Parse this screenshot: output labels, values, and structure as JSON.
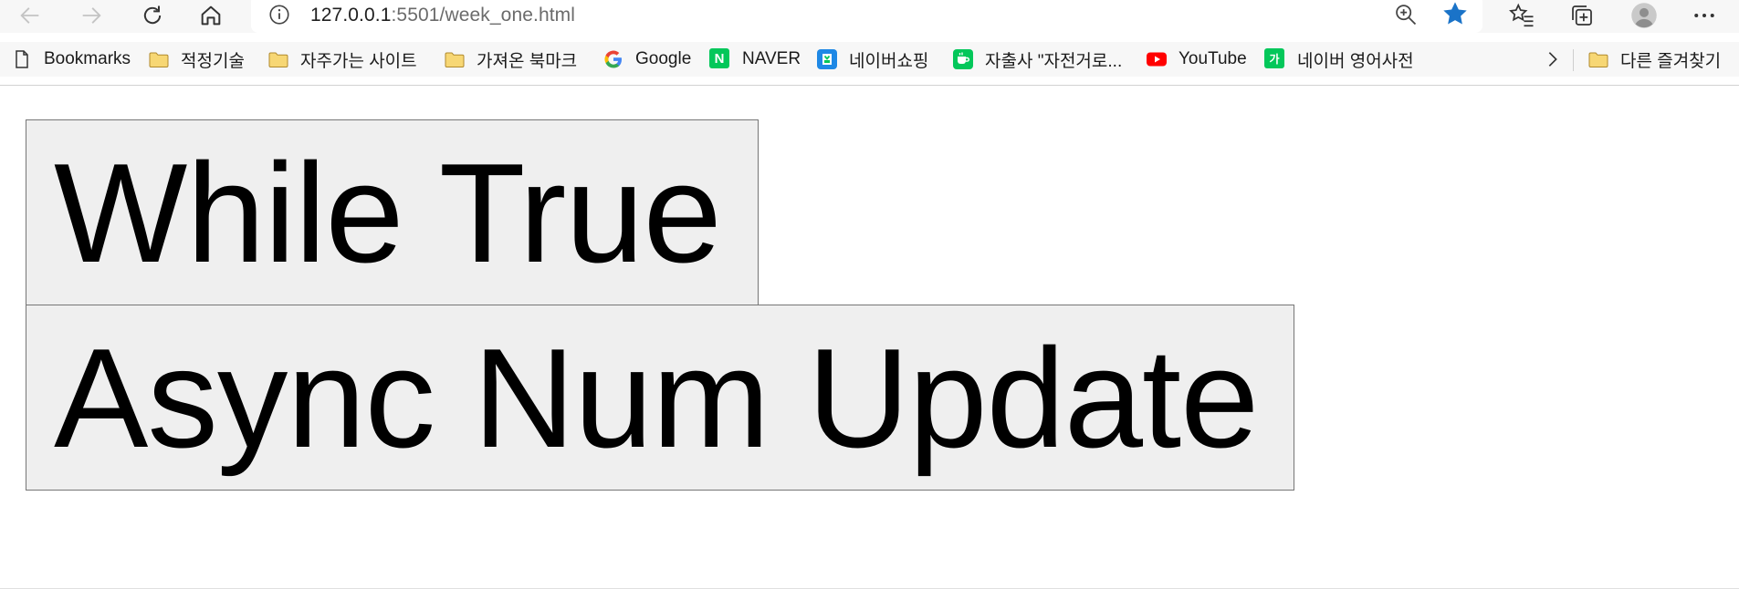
{
  "browser": {
    "url_host": "127.0.0.1",
    "url_path": ":5501/week_one.html",
    "nav_icons": [
      "back-arrow-icon",
      "forward-arrow-icon",
      "refresh-icon",
      "home-icon"
    ],
    "right_icons": [
      "favorites-icon",
      "collections-icon",
      "profile-avatar",
      "more-options-icon"
    ]
  },
  "bookmarks": {
    "items": [
      {
        "label": "Bookmarks",
        "icon": "bookmark-page-icon"
      },
      {
        "label": "적정기술",
        "icon": "folder-icon"
      },
      {
        "label": "자주가는 사이트",
        "icon": "folder-icon"
      },
      {
        "label": "가져온 북마크",
        "icon": "folder-icon"
      },
      {
        "label": "Google",
        "icon": "google-icon"
      },
      {
        "label": "NAVER",
        "icon": "naver-icon"
      },
      {
        "label": "네이버쇼핑",
        "icon": "naver-shopping-icon"
      },
      {
        "label": "자출사 \"자전거로...",
        "icon": "cafe-icon"
      },
      {
        "label": "YouTube",
        "icon": "youtube-icon"
      },
      {
        "label": "네이버 영어사전",
        "icon": "naver-dictionary-icon"
      }
    ],
    "other_folder_label": "다른 즐겨찾기",
    "badge_text": {
      "naver": "N",
      "dictionary": "가"
    }
  },
  "page": {
    "buttons": [
      {
        "label": "While True"
      },
      {
        "label": "Async Num Update"
      }
    ]
  },
  "colors": {
    "star_active": "#1a73c8",
    "folder_fill": "#f7d774",
    "naver_green": "#03c75a",
    "youtube_red": "#ff0000",
    "button_bg": "#efefef"
  }
}
